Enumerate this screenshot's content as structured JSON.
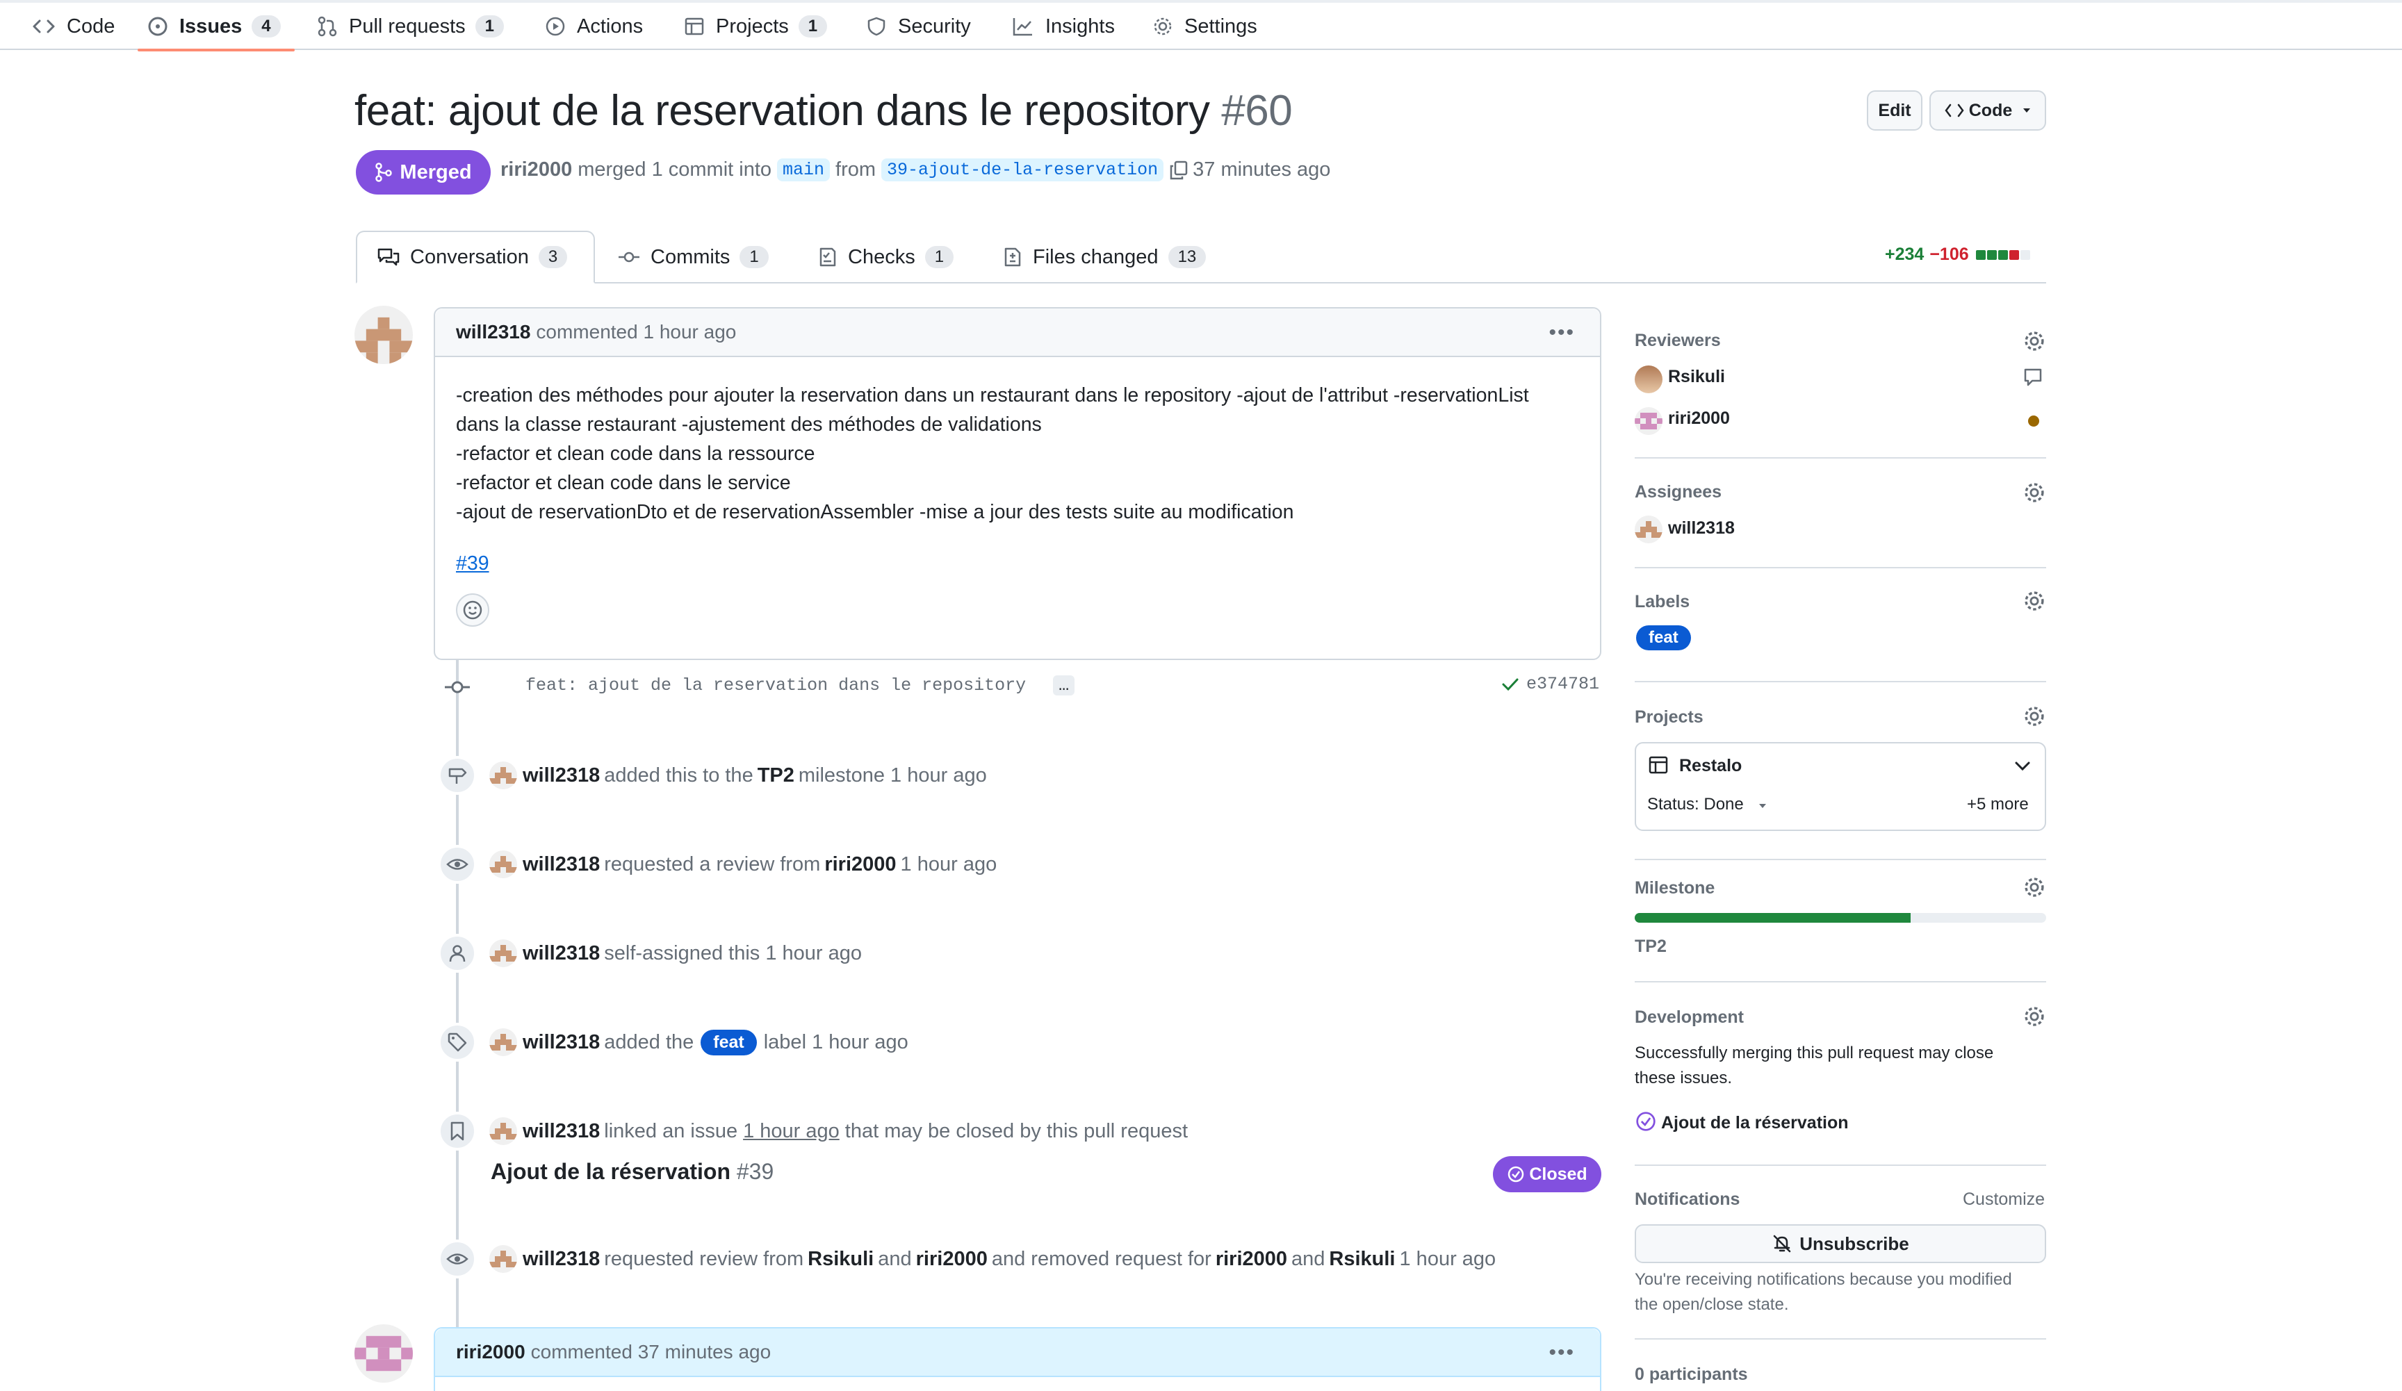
{
  "nav": {
    "items": [
      {
        "label": "Code",
        "icon": "code-icon"
      },
      {
        "label": "Issues",
        "icon": "issue-icon",
        "count": "4"
      },
      {
        "label": "Pull requests",
        "icon": "pull-request-icon",
        "count": "1"
      },
      {
        "label": "Actions",
        "icon": "play-icon"
      },
      {
        "label": "Projects",
        "icon": "table-icon",
        "count": "1"
      },
      {
        "label": "Security",
        "icon": "shield-icon"
      },
      {
        "label": "Insights",
        "icon": "graph-icon"
      },
      {
        "label": "Settings",
        "icon": "gear-icon"
      }
    ],
    "accent": "#fd8c73"
  },
  "pr": {
    "title": "feat: ajout de la reservation dans le repository",
    "number": "#60",
    "edit_label": "Edit",
    "code_label": "Code",
    "state": "Merged",
    "author": "riri2000",
    "merged_text": "merged 1 commit into",
    "base_branch": "main",
    "from_text": "from",
    "head_branch": "39-ajout-de-la-reservation",
    "time": "37 minutes ago"
  },
  "tabs": [
    {
      "label": "Conversation",
      "count": "3"
    },
    {
      "label": "Commits",
      "count": "1"
    },
    {
      "label": "Checks",
      "count": "1"
    },
    {
      "label": "Files changed",
      "count": "13"
    }
  ],
  "diffstat": {
    "additions": "+234",
    "deletions": "−106"
  },
  "first_comment": {
    "author": "will2318",
    "meta": "commented 1 hour ago",
    "lines": [
      "-creation des méthodes pour ajouter la reservation dans un restaurant dans le repository -ajout de l'attribut -reservationList",
      "dans la classe restaurant -ajustement des méthodes de validations",
      "-refactor et clean code dans la ressource",
      "-refactor et clean code dans le service",
      "-ajout de reservationDto et de reservationAssembler -mise a jour des tests suite au modification"
    ],
    "link": "#39"
  },
  "commit": {
    "message": "feat: ajout de la reservation dans le repository",
    "ellipsis": "…",
    "sha": "e374781"
  },
  "events": {
    "milestone": {
      "user": "will2318",
      "pre": "added this to the",
      "milestone": "TP2",
      "post": "milestone 1 hour ago"
    },
    "review_request": {
      "user": "will2318",
      "pre": "requested a review from",
      "target": "riri2000",
      "post": "1 hour ago"
    },
    "self_assign": {
      "user": "will2318",
      "text": "self-assigned this 1 hour ago"
    },
    "label": {
      "user": "will2318",
      "pre": "added the",
      "label": "feat",
      "post": "label 1 hour ago"
    },
    "linked": {
      "user": "will2318",
      "pre": "linked an issue",
      "time": "1 hour ago",
      "post": "that may be closed by this pull request",
      "issue_title": "Ajout de la réservation",
      "issue_number": "#39",
      "issue_state": "Closed"
    },
    "review_change": {
      "user": "will2318",
      "t1": "requested review from",
      "u1": "Rsikuli",
      "t2": "and",
      "u2": "riri2000",
      "t3": "and removed request for",
      "u3": "riri2000",
      "t4": "and",
      "u4": "Rsikuli",
      "t5": "1 hour ago"
    }
  },
  "second_comment": {
    "author": "riri2000",
    "meta": "commented 37 minutes ago"
  },
  "sidebar": {
    "reviewers_title": "Reviewers",
    "reviewers": [
      "Rsikuli",
      "riri2000"
    ],
    "assignees_title": "Assignees",
    "assignee": "will2318",
    "labels_title": "Labels",
    "label": "feat",
    "projects_title": "Projects",
    "project_name": "Restalo",
    "project_status": "Status: Done",
    "project_more": "+5 more",
    "milestone_title": "Milestone",
    "milestone_name": "TP2",
    "milestone_progress": 0.67,
    "development_title": "Development",
    "development_text_1": "Successfully merging this pull request may close",
    "development_text_2": "these issues.",
    "development_issue": "Ajout de la réservation",
    "notifications_title": "Notifications",
    "customize_label": "Customize",
    "unsubscribe_label": "Unsubscribe",
    "notif_text_1": "You're receiving notifications because you modified",
    "notif_text_2": "the open/close state.",
    "participants": "0 participants"
  },
  "colors": {
    "merged": "#8250df",
    "link": "#0969da",
    "label": "#0b5bd3",
    "progress": "#1f883d"
  }
}
